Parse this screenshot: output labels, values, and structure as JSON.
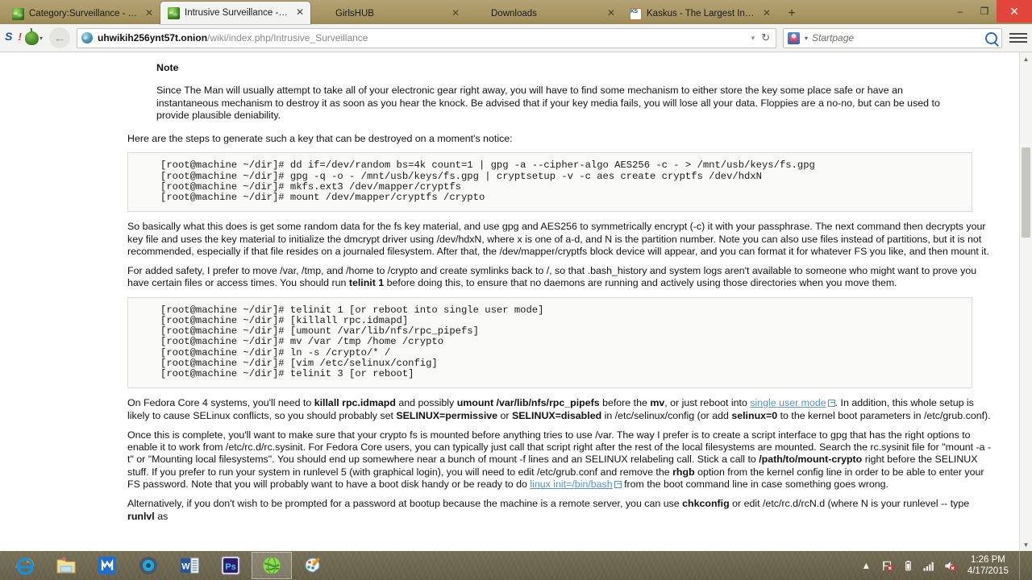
{
  "window": {
    "controls": {
      "minimize": "–",
      "restore": "❐",
      "close": "✕"
    }
  },
  "tabs": [
    {
      "title": "Category:Surveillance - Th...",
      "favicon": "globe-icon",
      "active": false,
      "close": "✕"
    },
    {
      "title": "Intrusive Surveillance - The...",
      "favicon": "globe-icon",
      "active": true,
      "close": "✕"
    },
    {
      "title": "GirlsHUB",
      "favicon": "none",
      "active": false,
      "close": "✕"
    },
    {
      "title": "Downloads",
      "favicon": "none",
      "active": false,
      "close": "✕"
    },
    {
      "title": "Kaskus - The Largest Indon...",
      "favicon": "kaskus-icon",
      "active": false,
      "close": "✕"
    }
  ],
  "newtab_label": "+",
  "toolbar": {
    "startpage_icon": "S",
    "onion_menu_caret": "▾",
    "back_arrow": "←",
    "url_domain": "uhwikih256ynt57t.onion",
    "url_path": "/wiki/index.php/Intrusive_Surveillance",
    "url_dropdown": "▾",
    "reload": "↻",
    "search_placeholder": "Startpage",
    "search_value": "",
    "search_engine_caret": "▾",
    "menu_icon": "hamburger-icon"
  },
  "scrollbar": {
    "up": "▲",
    "down": "▼"
  },
  "page": {
    "note": {
      "heading": "Note",
      "body": "Since The Man will usually attempt to take all of your electronic gear right away, you will have to find some mechanism to either store the key some place safe or have an instantaneous mechanism to destroy it as soon as you hear the knock. Be advised that if your key media fails, you will lose all your data. Floppies are a no-no, but can be used to provide plausible deniability."
    },
    "intro_line": "Here are the steps to generate such a key that can be destroyed on a moment's notice:",
    "code_block_1": "[root@machine ~/dir]# dd if=/dev/random bs=4k count=1 | gpg -a --cipher-algo AES256 -c - > /mnt/usb/keys/fs.gpg\n[root@machine ~/dir]# gpg -q -o - /mnt/usb/keys/fs.gpg | cryptsetup -v -c aes create cryptfs /dev/hdxN\n[root@machine ~/dir]# mkfs.ext3 /dev/mapper/cryptfs\n[root@machine ~/dir]# mount /dev/mapper/cryptfs /crypto",
    "para_2": "So basically what this does is get some random data for the fs key material, and use gpg and AES256 to symmetrically encrypt (-c) it with your passphrase. The next command then decrypts your key file and uses the key material to initialize the dmcrypt driver using /dev/hdxN, where x is one of a-d, and N is the partition number. Note you can also use files instead of partitions, but it is not recommended, especially if that file resides on a journaled filesystem. After that, the /dev/mapper/cryptfs block device will appear, and you can format it for whatever FS you like, and then mount it.",
    "para_3_a": "For added safety, I prefer to move /var, /tmp, and /home to /crypto and create symlinks back to /, so that .bash_history and system logs aren't available to someone who might want to prove you have certain files or access times. You should run ",
    "para_3_b": "telinit 1",
    "para_3_c": " before doing this, to ensure that no daemons are running and actively using those directories when you move them.",
    "code_block_2": "[root@machine ~/dir]# telinit 1 [or reboot into single user mode]\n[root@machine ~/dir]# [killall rpc.idmapd]\n[root@machine ~/dir]# [umount /var/lib/nfs/rpc_pipefs]\n[root@machine ~/dir]# mv /var /tmp /home /crypto\n[root@machine ~/dir]# ln -s /crypto/* /\n[root@machine ~/dir]# [vim /etc/selinux/config]\n[root@machine ~/dir]# telinit 3 [or reboot]",
    "para_4": {
      "t1": "On Fedora Core 4 systems, you'll need to ",
      "b1": "killall rpc.idmapd",
      "t2": " and possibly ",
      "b2": "umount /var/lib/nfs/rpc_pipefs",
      "t3": " before the ",
      "b3": "mv",
      "t4": ", or just reboot into ",
      "link": "single user mode",
      "t5": ". In addition, this whole setup is likely to cause SELinux conflicts, so you should probably set ",
      "b4": "SELINUX=permissive",
      "t6": " or ",
      "b5": "SELINUX=disabled",
      "t7": " in /etc/selinux/config (or add ",
      "b6": "selinux=0",
      "t8": " to the kernel boot parameters in /etc/grub.conf)."
    },
    "para_5": {
      "t1": "Once this is complete, you'll want to make sure that your crypto fs is mounted before anything tries to use /var. The way I prefer is to create a script interface to gpg that has the right options to enable it to work from /etc/rc.d/rc.sysinit. For Fedora Core users, you can typically just call that script right after the rest of the local filesystems are mounted. Search the rc.sysinit file for \"mount -a -t\" or \"Mounting local filesystems\". You should end up somewhere near a bunch of mount -f lines and an SELINUX relabeling call. Stick a call to ",
      "b1": "/path/to/mount-crypto",
      "t2": " right before the SELINUX stuff. If you prefer to run your system in runlevel 5 (with graphical login), you will need to edit /etc/grub.conf and remove the ",
      "b2": "rhgb",
      "t3": " option from the kernel config line in order to be able to enter your FS password. Note that you will probably want to have a boot disk handy or be ready to do ",
      "link": "linux init=/bin/bash",
      "t4": " from the boot command line in case something goes wrong."
    },
    "para_6": {
      "t1": "Alternatively, if you don't wish to be prompted for a password at bootup because the machine is a remote server, you can use ",
      "b1": "chkconfig",
      "t2": " or edit /etc/rc.d/rcN.d (where N is your runlevel -- type ",
      "b2": "runlvl",
      "t3": " as"
    }
  },
  "taskbar": {
    "items": [
      {
        "name": "internet-explorer",
        "label": "Internet Explorer",
        "running": false
      },
      {
        "name": "file-explorer",
        "label": "File Explorer",
        "running": false
      },
      {
        "name": "maxthon-browser",
        "label": "Maxthon",
        "running": false
      },
      {
        "name": "media-player",
        "label": "Media Player",
        "running": false
      },
      {
        "name": "microsoft-word",
        "label": "Microsoft Word",
        "running": false
      },
      {
        "name": "photoshop",
        "label": "Adobe Photoshop",
        "running": false
      },
      {
        "name": "tor-browser",
        "label": "Tor Browser",
        "running": true
      },
      {
        "name": "paint",
        "label": "Paint",
        "running": false
      }
    ],
    "tray": {
      "show_hidden": "▲",
      "flag_icon": "flag-icon",
      "battery_icon": "battery-icon",
      "network_icon": "signal-icon",
      "volume_icon": "volume-muted-icon"
    },
    "clock": {
      "time": "1:26 PM",
      "date": "4/17/2015"
    }
  }
}
